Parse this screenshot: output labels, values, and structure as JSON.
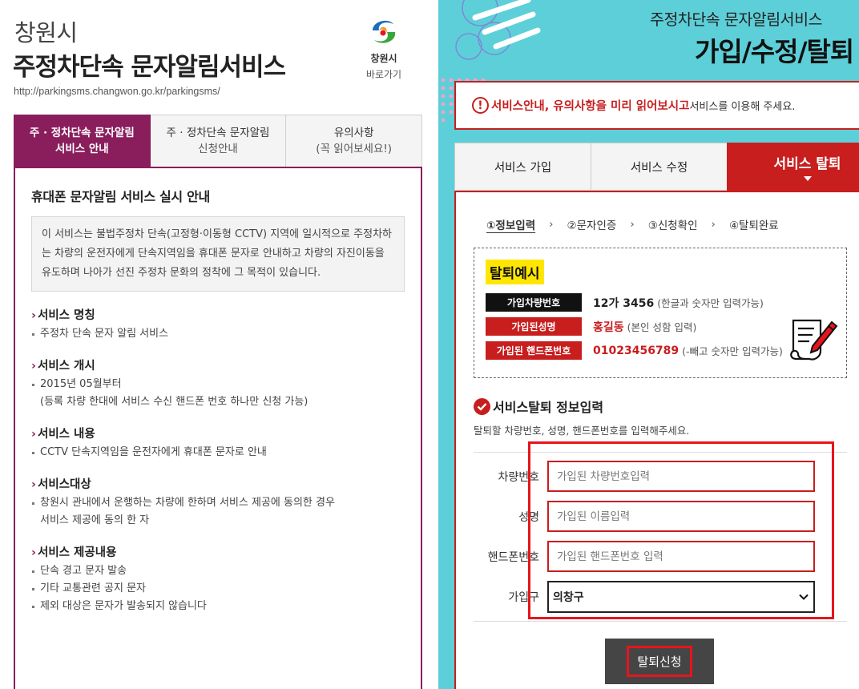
{
  "left": {
    "city": "창원시",
    "service_title": "주정차단속 문자알림서비스",
    "url": "http://parkingsms.changwon.go.kr/parkingsms/",
    "logo": {
      "name": "창원시",
      "link": "바로가기",
      "icon": "changwon-logo-icon"
    },
    "tabs": [
      {
        "line1": "주 · 정차단속 문자알림",
        "line2": "서비스 안내",
        "active": true
      },
      {
        "line1": "주 · 정차단속 문자알림",
        "line2": "신청안내",
        "active": false
      },
      {
        "line1": "유의사항",
        "line2": "(꼭 읽어보세요!)",
        "active": false
      }
    ],
    "heading": "휴대폰 문자알림 서비스 실시 안내",
    "intro": "이 서비스는 불법주정차 단속(고정형·이동형 CCTV) 지역에 일시적으로 주정차하는 차량의 운전자에게 단속지역임을 휴대폰 문자로 안내하고 차량의 자진이동을 유도하며 나아가 선진 주정차 문화의 정착에 그 목적이 있습니다.",
    "sections": [
      {
        "title": "서비스 명칭",
        "items": [
          "주정차 단속 문자 알림 서비스"
        ]
      },
      {
        "title": "서비스 개시",
        "items": [
          "2015년 05월부터",
          "(등록 차량 한대에 서비스 수신 핸드폰 번호 하나만 신청 가능)"
        ]
      },
      {
        "title": "서비스 내용",
        "items": [
          "CCTV 단속지역임을 운전자에게 휴대폰 문자로 안내"
        ]
      },
      {
        "title": "서비스대상",
        "items": [
          "창원시 관내에서 운행하는 차량에 한하며 서비스 제공에 동의한 경우",
          "서비스 제공에 동의 한 자"
        ]
      },
      {
        "title": "서비스 제공내용",
        "items": [
          "단속 경고 문자 발송",
          "기타 교통관련 공지 문자",
          "제외 대상은 문자가 발송되지 않습니다"
        ]
      }
    ]
  },
  "right": {
    "subtitle": "주정차단속 문자알림서비스",
    "title": "가입/수정/탈퇴",
    "notice": {
      "red": "서비스안내, 유의사항을 미리 읽어보시고",
      "rest": " 서비스를 이용해 주세요."
    },
    "tabs": [
      "서비스 가입",
      "서비스 수정",
      "서비스 탈퇴"
    ],
    "steps": [
      "①정보입력",
      "②문자인증",
      "③신청확인",
      "④탈퇴완료"
    ],
    "example": {
      "badge": "탈퇴예시",
      "rows": [
        {
          "label": "가입차량번호",
          "value": "12가 3456",
          "hint": "(한글과 숫자만 입력가능)"
        },
        {
          "label": "가입된성명",
          "value": "홍길동",
          "hint": "(본인 성함 입력)"
        },
        {
          "label": "가입된 핸드폰번호",
          "value": "01023456789",
          "hint": "(-빼고 숫자만 입력가능)"
        }
      ]
    },
    "form": {
      "title": "서비스탈퇴 정보입력",
      "desc": "탈퇴할 차량번호, 성명, 핸드폰번호를 입력해주세요.",
      "car_label": "차량번호",
      "car_placeholder": "가입된 차량번호입력",
      "name_label": "성명",
      "name_placeholder": "가입된 이름입력",
      "phone_label": "핸드폰번호",
      "phone_placeholder": "가입된 핸드폰번호 입력",
      "district_label": "가입구",
      "district_value": "의창구"
    },
    "submit": "탈퇴신청"
  }
}
